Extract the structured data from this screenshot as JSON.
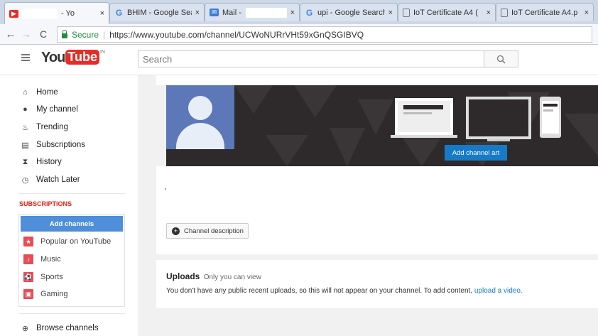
{
  "browser": {
    "tabs": [
      {
        "title": "- Yo",
        "icon": "youtube-icon",
        "close": "×",
        "active": true
      },
      {
        "title": "BHIM - Google Sea",
        "icon": "google-icon",
        "close": "×"
      },
      {
        "title": "Mail -",
        "icon": "mail-icon",
        "close": "×"
      },
      {
        "title": "upi - Google Search",
        "icon": "google-icon",
        "close": "×"
      },
      {
        "title": "IoT Certificate A4 (",
        "icon": "document-icon",
        "close": "×"
      },
      {
        "title": "IoT Certificate A4.p",
        "icon": "document-icon",
        "close": "×"
      }
    ],
    "secure_label": "Secure",
    "url": "https://www.youtube.com/channel/UCWoNURrVHt59xGnQSGIBVQ"
  },
  "header": {
    "logo_you": "You",
    "logo_tube": "Tube",
    "country": "IN",
    "search_placeholder": "Search"
  },
  "sidebar": {
    "items": [
      {
        "label": "Home",
        "icon": "home-icon"
      },
      {
        "label": "My channel",
        "icon": "my-channel-icon"
      },
      {
        "label": "Trending",
        "icon": "trending-icon"
      },
      {
        "label": "Subscriptions",
        "icon": "subscriptions-icon"
      },
      {
        "label": "History",
        "icon": "history-icon"
      },
      {
        "label": "Watch Later",
        "icon": "watch-later-icon"
      }
    ],
    "subscriptions_heading": "SUBSCRIPTIONS",
    "add_channels_label": "Add channels",
    "subscriptions": [
      {
        "label": "Popular on YouTube",
        "icon": "star-icon"
      },
      {
        "label": "Music",
        "icon": "music-icon"
      },
      {
        "label": "Sports",
        "icon": "sports-icon"
      },
      {
        "label": "Gaming",
        "icon": "gaming-icon"
      }
    ],
    "browse_channels_label": "Browse channels"
  },
  "main": {
    "add_channel_art_label": "Add channel art",
    "channel_name_mark": "'",
    "channel_description_label": "Channel description",
    "uploads_title": "Uploads",
    "uploads_visibility": "Only you can view",
    "uploads_message": "You don't have any public recent uploads, so this will not appear on your channel. To add content,",
    "upload_link": "upload a video."
  },
  "colors": {
    "youtube_red": "#e52d27",
    "link_blue": "#167ac6",
    "add_channels_blue": "#4f8fd9",
    "subscriptions_red": "#e62117",
    "banner_dark": "#2e2a2c",
    "avatar_blue": "#5c78b9"
  }
}
